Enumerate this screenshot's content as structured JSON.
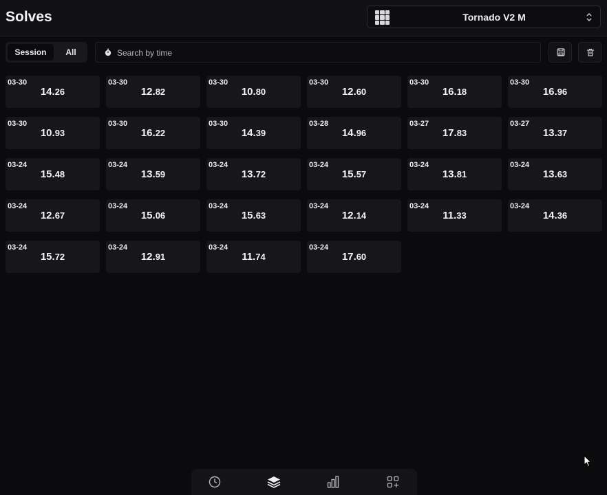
{
  "header": {
    "title": "Solves",
    "cube_select": {
      "icon": "cube-grid-icon",
      "value": "Tornado V2 M"
    }
  },
  "toolbar": {
    "tabs": [
      {
        "label": "Session",
        "active": true
      },
      {
        "label": "All",
        "active": false
      }
    ],
    "search": {
      "placeholder": "Search by time",
      "value": ""
    },
    "save_icon": "save-icon",
    "delete_icon": "trash-icon"
  },
  "solves": [
    {
      "date": "03-30",
      "whole": "14.",
      "frac": "26"
    },
    {
      "date": "03-30",
      "whole": "12.",
      "frac": "82"
    },
    {
      "date": "03-30",
      "whole": "10.",
      "frac": "80"
    },
    {
      "date": "03-30",
      "whole": "12.",
      "frac": "60"
    },
    {
      "date": "03-30",
      "whole": "16.",
      "frac": "18"
    },
    {
      "date": "03-30",
      "whole": "16.",
      "frac": "96"
    },
    {
      "date": "03-30",
      "whole": "10.",
      "frac": "93"
    },
    {
      "date": "03-30",
      "whole": "16.",
      "frac": "22"
    },
    {
      "date": "03-30",
      "whole": "14.",
      "frac": "39"
    },
    {
      "date": "03-28",
      "whole": "14.",
      "frac": "96"
    },
    {
      "date": "03-27",
      "whole": "17.",
      "frac": "83"
    },
    {
      "date": "03-27",
      "whole": "13.",
      "frac": "37"
    },
    {
      "date": "03-24",
      "whole": "15.",
      "frac": "48"
    },
    {
      "date": "03-24",
      "whole": "13.",
      "frac": "59"
    },
    {
      "date": "03-24",
      "whole": "13.",
      "frac": "72"
    },
    {
      "date": "03-24",
      "whole": "15.",
      "frac": "57"
    },
    {
      "date": "03-24",
      "whole": "13.",
      "frac": "81"
    },
    {
      "date": "03-24",
      "whole": "13.",
      "frac": "63"
    },
    {
      "date": "03-24",
      "whole": "12.",
      "frac": "67"
    },
    {
      "date": "03-24",
      "whole": "15.",
      "frac": "06"
    },
    {
      "date": "03-24",
      "whole": "15.",
      "frac": "63"
    },
    {
      "date": "03-24",
      "whole": "12.",
      "frac": "14"
    },
    {
      "date": "03-24",
      "whole": "11.",
      "frac": "33"
    },
    {
      "date": "03-24",
      "whole": "14.",
      "frac": "36"
    },
    {
      "date": "03-24",
      "whole": "15.",
      "frac": "72"
    },
    {
      "date": "03-24",
      "whole": "12.",
      "frac": "91"
    },
    {
      "date": "03-24",
      "whole": "11.",
      "frac": "74"
    },
    {
      "date": "03-24",
      "whole": "17.",
      "frac": "60"
    }
  ],
  "bottom_nav": [
    {
      "icon": "timer-icon",
      "active": false
    },
    {
      "icon": "layers-icon",
      "active": true
    },
    {
      "icon": "bar-chart-icon",
      "active": false
    },
    {
      "icon": "apps-add-icon",
      "active": false
    }
  ],
  "colors": {
    "background": "#0b0b0d",
    "card": "#17171b",
    "text": "#f4f4f6"
  }
}
